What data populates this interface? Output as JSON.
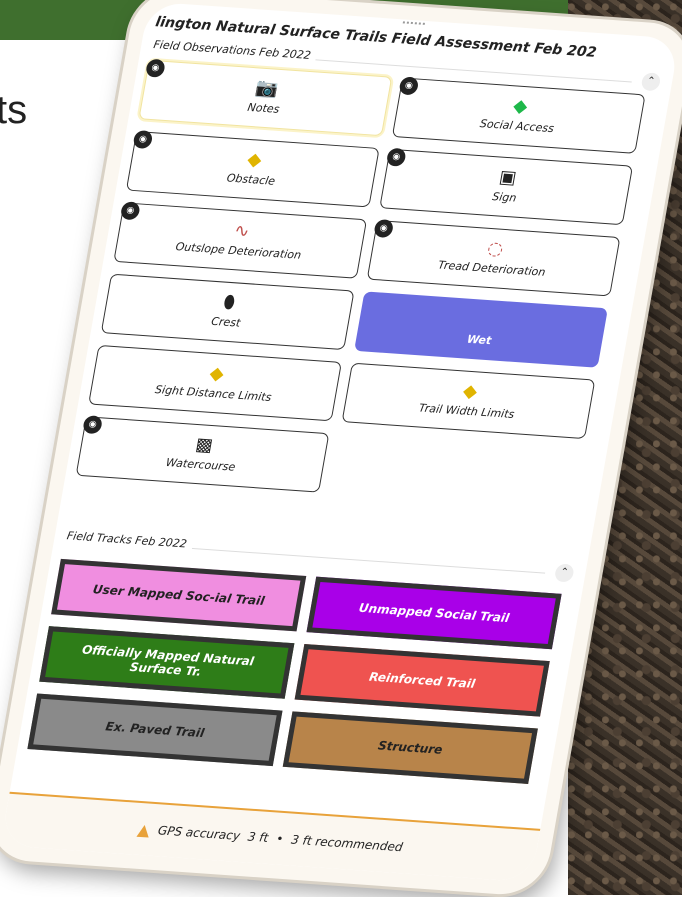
{
  "slide": {
    "fragment_text": "ts"
  },
  "app": {
    "title": "lington Natural Surface Trails Field Assessment Feb 202"
  },
  "observations": {
    "header": "Field Observations Feb 2022",
    "collapse_icon": "chevron-up-icon",
    "items": [
      {
        "label": "Notes",
        "icon": "camera-icon",
        "has_camera": true,
        "selected": true
      },
      {
        "label": "Social Access",
        "icon": "diamond-icon",
        "has_camera": true
      },
      {
        "label": "Obstacle",
        "icon": "warning-icon",
        "has_camera": true
      },
      {
        "label": "Sign",
        "icon": "sign-icon",
        "has_camera": true
      },
      {
        "label": "Outslope Deterioration",
        "icon": "squiggle-icon",
        "has_camera": true
      },
      {
        "label": "Tread Deterioration",
        "icon": "dashed-arc-icon",
        "has_camera": true
      },
      {
        "label": "Crest",
        "icon": "location-pin-icon",
        "has_camera": false
      },
      {
        "label": "Wet",
        "icon": "",
        "has_camera": false,
        "active": true,
        "color": "#6a6de0"
      },
      {
        "label": "Sight Distance Limits",
        "icon": "curve-sign-icon",
        "has_camera": false
      },
      {
        "label": "Trail Width Limits",
        "icon": "narrow-road-sign-icon",
        "has_camera": false
      },
      {
        "label": "Watercourse",
        "icon": "hiker-icon",
        "has_camera": true
      }
    ]
  },
  "tracks": {
    "header": "Field Tracks Feb 2022",
    "collapse_icon": "chevron-up-icon",
    "items": [
      {
        "label": "User Mapped Soc-ial Trail",
        "color": "#f08ee0"
      },
      {
        "label": "Unmapped Social Trail",
        "color": "#a900e8"
      },
      {
        "label": "Officially Mapped Natural Surface Tr.",
        "color": "#2e7d18"
      },
      {
        "label": "Reinforced Trail",
        "color": "#ef5350"
      },
      {
        "label": "Ex. Paved Trail",
        "color": "#8a8a8a"
      },
      {
        "label": "Structure",
        "color": "#b8844a"
      }
    ]
  },
  "gps": {
    "icon": "warning-icon",
    "label": "GPS accuracy",
    "value": "3 ft",
    "separator": "•",
    "recommended": "3 ft recommended"
  }
}
